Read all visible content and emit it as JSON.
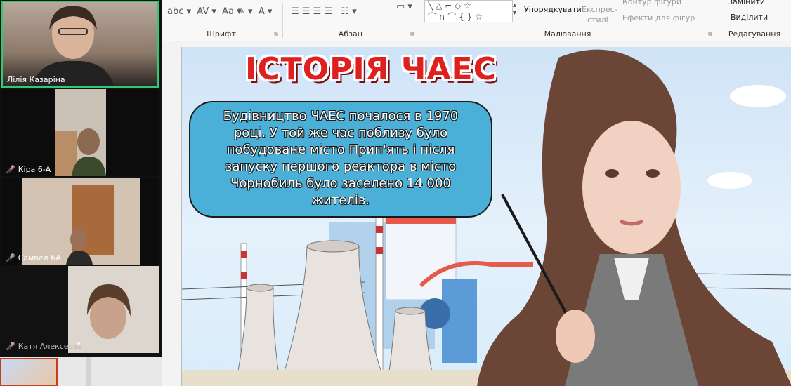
{
  "ribbon": {
    "font_group": "Шрифт",
    "paragraph_group": "Абзац",
    "drawing_group": "Малювання",
    "editing_group": "Редагування",
    "arrange": "Упорядкувати",
    "quick_styles_1": "Експрес-",
    "quick_styles_2": "стилі",
    "shape_outline": "Контур фігури",
    "shape_effects": "Ефекти для фігур",
    "replace": "Замінити",
    "select": "Виділити"
  },
  "participants": [
    {
      "name": "Лілія Казаріна",
      "muted": false
    },
    {
      "name": "Кіра 6-А",
      "muted": true
    },
    {
      "name": "Самвел 6А",
      "muted": true
    },
    {
      "name": "Катя Алексеєва",
      "muted": true
    }
  ],
  "colors": {
    "active_speaker_border": "#2ecc71",
    "title_red": "#e0201f",
    "bubble_blue": "#4bb0d8"
  },
  "slide": {
    "title": "ІСТОРІЯ ЧАЕС",
    "text_lines": [
      "Будівництво ЧАЕС почалося в 1970",
      "році. У той же час поблизу було",
      "побудоване місто Прип'ять і після",
      "запуску першого реактора в місто",
      "Чорнобиль було заселено 14 000",
      "жителів."
    ]
  }
}
